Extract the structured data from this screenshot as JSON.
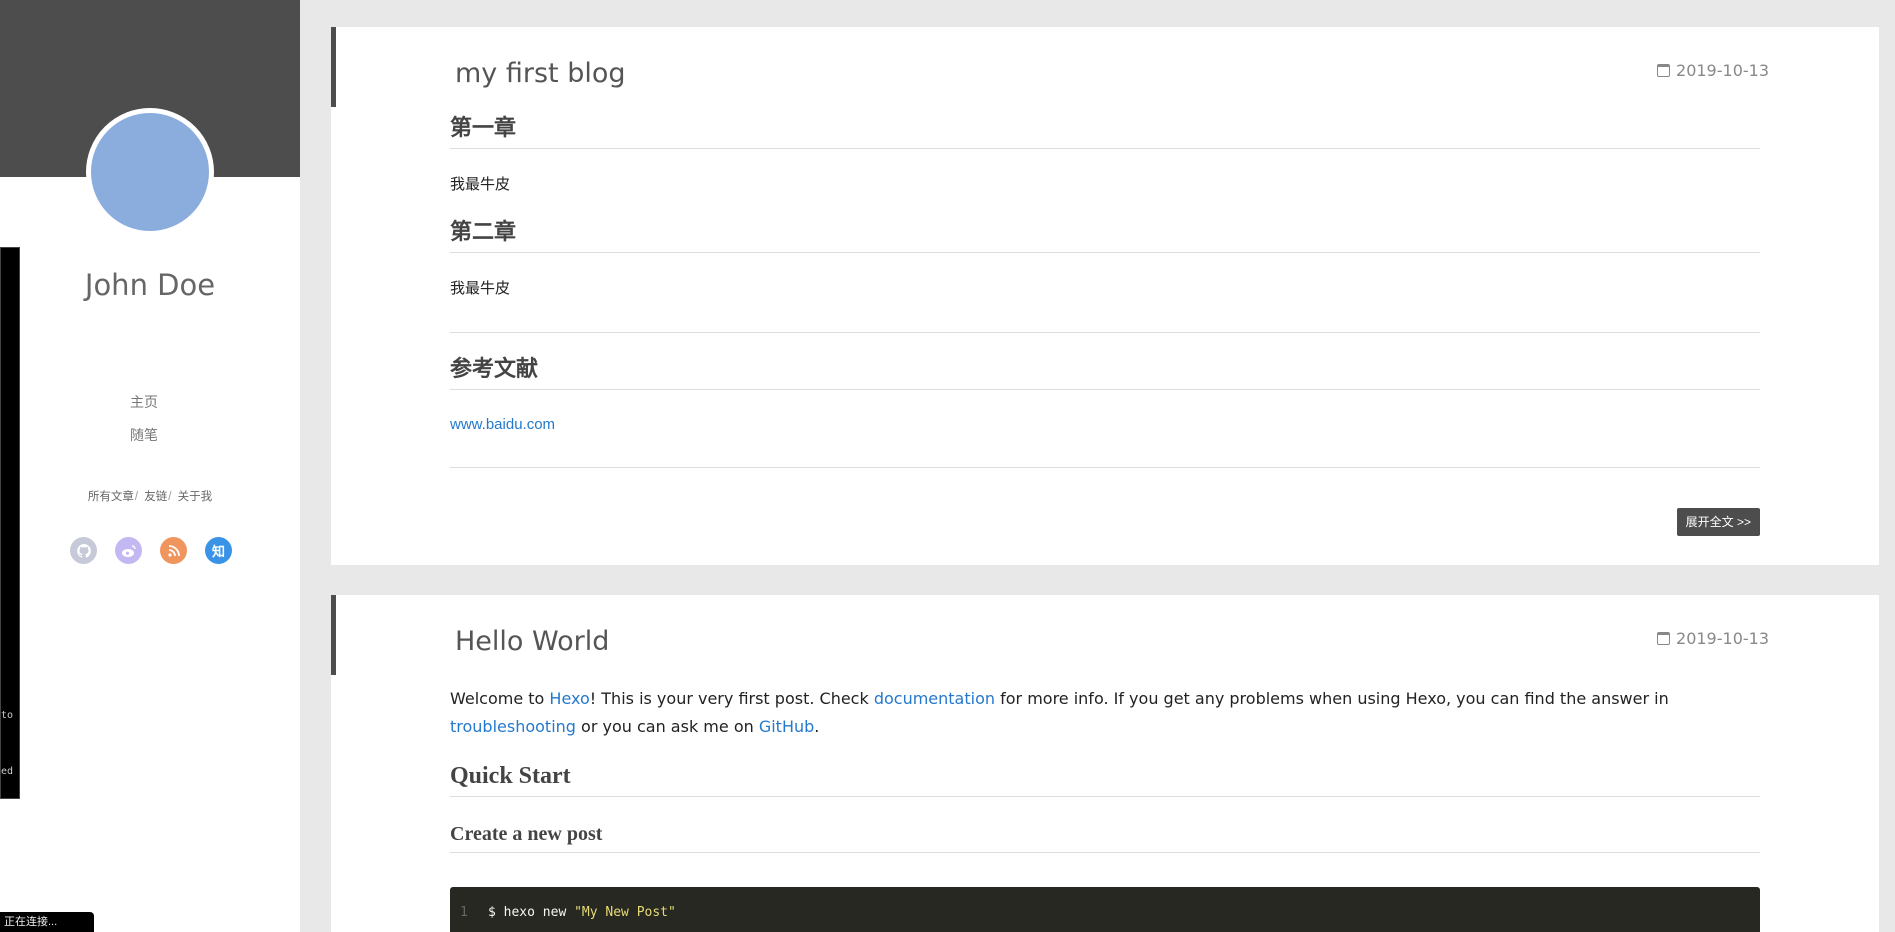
{
  "sidebar": {
    "author": "John Doe",
    "nav": [
      "主页",
      "随笔"
    ],
    "sublinks": [
      "所有文章",
      "友链",
      "关于我"
    ],
    "social": [
      {
        "name": "github-icon",
        "label": ""
      },
      {
        "name": "weibo-icon",
        "label": ""
      },
      {
        "name": "rss-icon",
        "label": ""
      },
      {
        "name": "zhihu-icon",
        "label": "知"
      }
    ]
  },
  "terminal": {
    "line1": "to",
    "line2": "ed"
  },
  "status": "正在连接...",
  "posts": [
    {
      "title": "my first blog",
      "date": "2019-10-13",
      "h1": "第一章",
      "p1": "我最牛皮",
      "h2": "第二章",
      "p2": "我最牛皮",
      "h3": "参考文献",
      "link": "www.baidu.com",
      "more": "展开全文 >>"
    },
    {
      "title": "Hello World",
      "date": "2019-10-13",
      "intro": {
        "t1": "Welcome to ",
        "l1": "Hexo",
        "t2": "! This is your very first post. Check ",
        "l2": "documentation",
        "t3": " for more info. If you get any problems when using Hexo, you can find the answer in ",
        "l3": "troubleshooting",
        "t4": " or you can ask me on ",
        "l4": "GitHub",
        "t5": "."
      },
      "h_quick": "Quick Start",
      "h_create": "Create a new post",
      "code": {
        "line_no": "1",
        "cmd": "$ hexo new ",
        "arg": "\"My New Post\""
      }
    }
  ]
}
